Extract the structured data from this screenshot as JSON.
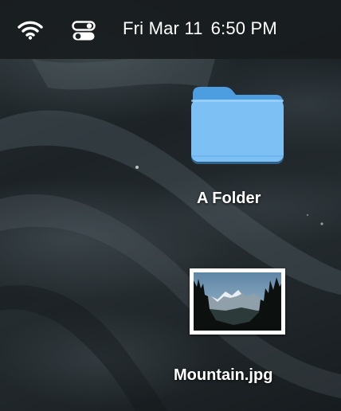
{
  "menubar": {
    "wifi_icon": "wifi-icon",
    "control_center_icon": "control-center-icon",
    "date": "Fri Mar 11",
    "time": "6:50 PM"
  },
  "desktop": {
    "items": [
      {
        "label": "A Folder",
        "icon": "folder-icon",
        "color": "#6fb8f0"
      },
      {
        "label": "Mountain.jpg",
        "icon": "image-thumbnail"
      }
    ]
  }
}
